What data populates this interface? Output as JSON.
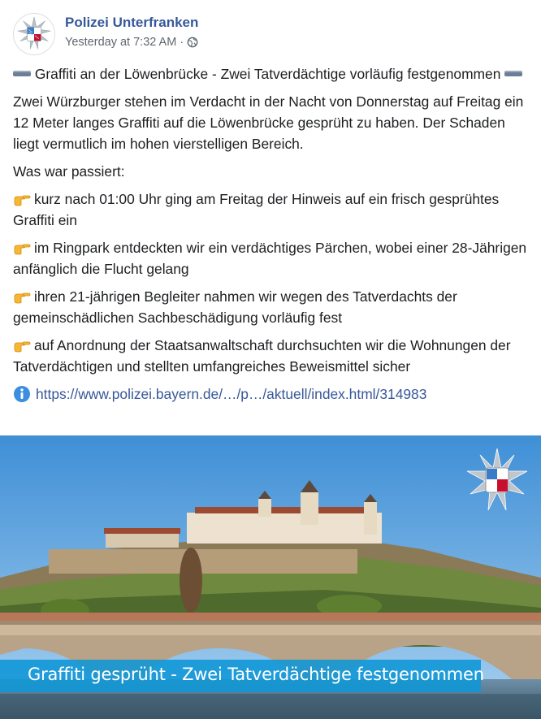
{
  "header": {
    "page_name": "Polizei Unterfranken",
    "timestamp": "Yesterday at 7:32 AM",
    "separator": "·",
    "privacy_icon": "globe-icon",
    "avatar_icon": "police-star-badge-icon"
  },
  "post": {
    "headline": "Graffiti an der Löwenbrücke - Zwei Tatverdächtige vorläufig festgenommen",
    "paragraph": "Zwei Würzburger stehen im Verdacht in der Nacht von Donnerstag auf Freitag ein 12 Meter langes Graffiti auf die Löwenbrücke gesprüht zu haben. Der Schaden liegt vermutlich im hohen vierstelligen Bereich.",
    "question": "Was war passiert:",
    "bullets": [
      "kurz nach 01:00 Uhr ging am Freitag der Hinweis auf ein frisch gesprühtes Graffiti ein",
      "im Ringpark entdeckten wir ein verdächtiges Pärchen, wobei einer 28-Jährigen anfänglich die Flucht gelang",
      "ihren 21-jährigen Begleiter nahmen wir wegen des Tatverdachts der gemeinschädlichen Sachbeschädigung vorläufig fest",
      "auf Anordnung der Staatsanwaltschaft durchsuchten wir die Wohnungen der Tatverdächtigen und stellten umfangreiches Beweismittel sicher"
    ],
    "bullet_icon": "pointing-hand-icon",
    "link": "https://www.polizei.bayern.de/…/p…/aktuell/index.html/314983",
    "link_icon": "info-icon"
  },
  "image": {
    "caption": "Graffiti gesprüht - Zwei Tatverdächtige festgenommen",
    "badge_icon": "police-star-badge-icon",
    "caption_color": "#0e96d6"
  },
  "colors": {
    "page_name": "#365899",
    "link": "#385898",
    "meta": "#616770"
  }
}
